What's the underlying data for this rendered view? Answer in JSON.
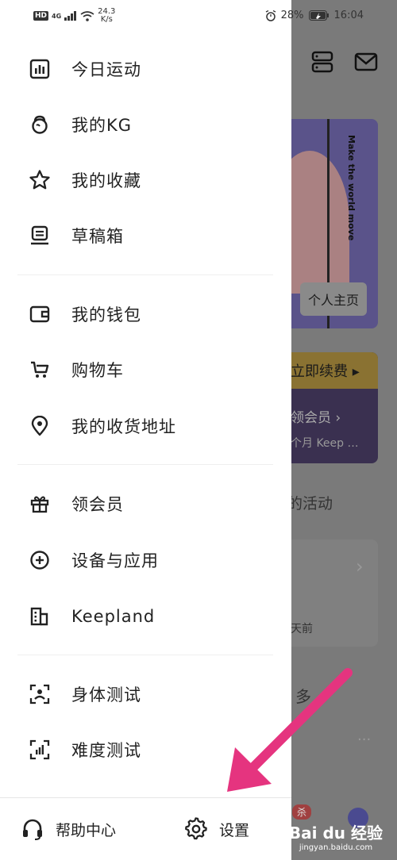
{
  "status_bar": {
    "hd": "HD",
    "network": "4G",
    "speed_value": "24.3",
    "speed_unit": "K/s",
    "battery": "28%",
    "time": "16:04"
  },
  "drawer": {
    "section1": [
      {
        "label": "今日运动",
        "icon": "stats-icon"
      },
      {
        "label": "我的KG",
        "icon": "kettlebell-icon"
      },
      {
        "label": "我的收藏",
        "icon": "star-icon"
      },
      {
        "label": "草稿箱",
        "icon": "drafts-icon"
      }
    ],
    "section2": [
      {
        "label": "我的钱包",
        "icon": "wallet-icon"
      },
      {
        "label": "购物车",
        "icon": "cart-icon"
      },
      {
        "label": "我的收货地址",
        "icon": "location-icon"
      }
    ],
    "section3": [
      {
        "label": "领会员",
        "icon": "gift-icon"
      },
      {
        "label": "设备与应用",
        "icon": "plus-circle-icon"
      },
      {
        "label": "Keepland",
        "icon": "building-icon"
      }
    ],
    "section4": [
      {
        "label": "身体测试",
        "icon": "body-scan-icon"
      },
      {
        "label": "难度测试",
        "icon": "difficulty-icon"
      }
    ],
    "bottom": {
      "help_label": "帮助中心",
      "settings_label": "设置"
    }
  },
  "background": {
    "banner_slogan": "Make the world move",
    "profile_button": "个人主页",
    "renew_label": "立即续费 ▸",
    "member_label": "领会员 ›",
    "member_desc": "个月 Keep …",
    "activity_label": "的活动",
    "chevron": "›",
    "days_ago": "天前",
    "more_label": "多",
    "ellipsis": "···",
    "sale_badge": "杀"
  },
  "watermark": {
    "line1": "Bai du 经验",
    "line2": "jingyan.baidu.com"
  },
  "annotation": {
    "arrow_color": "#e5347f"
  }
}
